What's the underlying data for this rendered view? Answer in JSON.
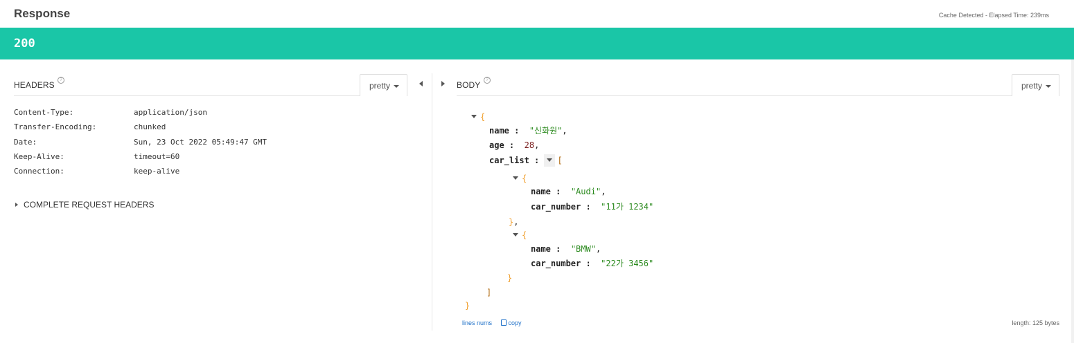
{
  "header": {
    "title": "Response",
    "cache_info": "Cache Detected - Elapsed Time: 239ms"
  },
  "status": {
    "code": "200",
    "color": "#1ac6a7"
  },
  "headers_panel": {
    "label": "HEADERS",
    "help_icon": "question-circle-icon",
    "format_select": "pretty",
    "rows": [
      {
        "key": "Content-Type:",
        "value": "application/json"
      },
      {
        "key": "Transfer-Encoding:",
        "value": "chunked"
      },
      {
        "key": "Date:",
        "value": "Sun, 23 Oct 2022 05:49:47 GMT"
      },
      {
        "key": "Keep-Alive:",
        "value": "timeout=60"
      },
      {
        "key": "Connection:",
        "value": "keep-alive"
      }
    ],
    "complete_request_label": "COMPLETE REQUEST HEADERS"
  },
  "body_panel": {
    "label": "BODY",
    "help_icon": "question-circle-icon",
    "format_select": "pretty",
    "json": {
      "name_key": "name",
      "name_value": "\"신화원\"",
      "age_key": "age",
      "age_value": "28",
      "car_list_key": "car_list",
      "cars": [
        {
          "name_key": "name",
          "name_value": "\"Audi\"",
          "number_key": "car_number",
          "number_value": "\"11가 1234\""
        },
        {
          "name_key": "name",
          "name_value": "\"BMW\"",
          "number_key": "car_number",
          "number_value": "\"22가 3456\""
        }
      ]
    },
    "footer": {
      "lines_nums": "lines nums",
      "copy": "copy",
      "length": "length: 125 bytes"
    }
  }
}
